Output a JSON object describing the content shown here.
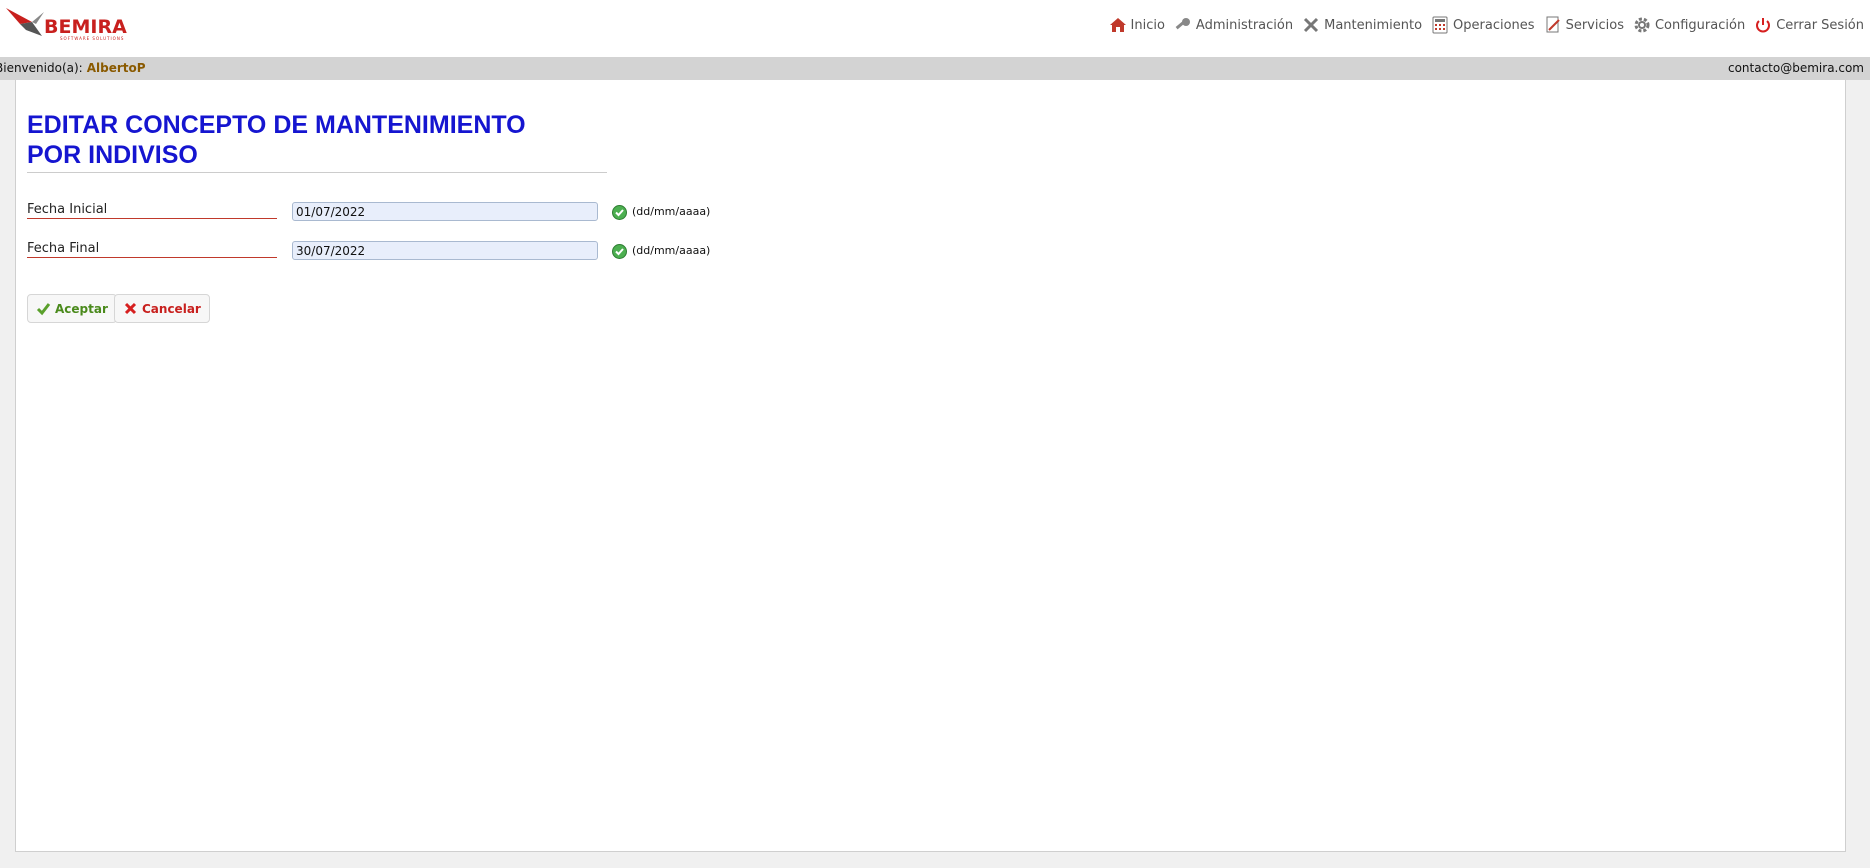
{
  "brand": {
    "name": "BEMIRA",
    "tagline": "SOFTWARE SOLUTIONS",
    "accent": "#c8201e"
  },
  "nav": {
    "items": [
      {
        "label": "Inicio",
        "icon": "home-icon"
      },
      {
        "label": "Administración",
        "icon": "key-icon"
      },
      {
        "label": "Mantenimiento",
        "icon": "tools-icon"
      },
      {
        "label": "Operaciones",
        "icon": "calculator-icon"
      },
      {
        "label": "Servicios",
        "icon": "document-edit-icon"
      },
      {
        "label": "Configuración",
        "icon": "gear-icon"
      },
      {
        "label": "Cerrar Sesión",
        "icon": "power-icon"
      }
    ]
  },
  "userbar": {
    "welcome_label": "Bienvenido(a):",
    "username": "AlbertoP",
    "contact": "contacto@bemira.com"
  },
  "page": {
    "title_line1": "EDITAR CONCEPTO DE MANTENIMIENTO",
    "title_line2": "POR INDIVISO",
    "title_color": "#1515d0"
  },
  "form": {
    "fecha_inicial": {
      "label": "Fecha Inicial",
      "value": "01/07/2022",
      "hint": "(dd/mm/aaaa)"
    },
    "fecha_final": {
      "label": "Fecha Final",
      "value": "30/07/2022",
      "hint": "(dd/mm/aaaa)"
    }
  },
  "buttons": {
    "accept": "Aceptar",
    "cancel": "Cancelar"
  }
}
